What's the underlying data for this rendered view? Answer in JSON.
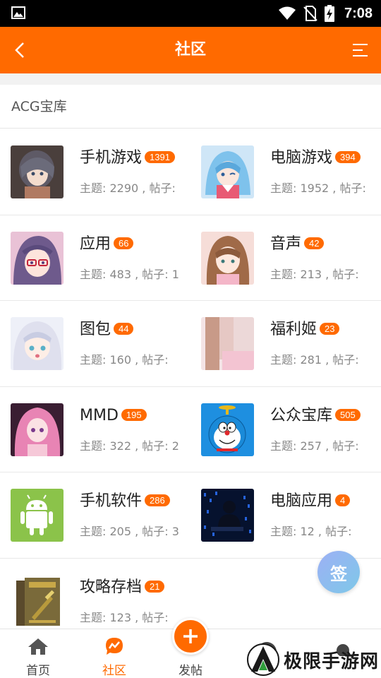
{
  "status_bar": {
    "time": "7:08",
    "icons": [
      "image-icon",
      "wifi-icon",
      "no-sim-icon",
      "battery-charging-icon"
    ]
  },
  "header": {
    "title": "社区",
    "back_icon": "chevron-left-icon",
    "menu_icon": "menu-lines-icon"
  },
  "section": {
    "title": "ACG宝库"
  },
  "categories": [
    {
      "name": "手机游戏",
      "count": "1391",
      "stats": "主题: 2290 , 帖子:"
    },
    {
      "name": "电脑游戏",
      "count": "394",
      "stats": "主题: 1952 , 帖子:"
    },
    {
      "name": "应用",
      "count": "66",
      "stats": "主题: 483 , 帖子: 1"
    },
    {
      "name": "音声",
      "count": "42",
      "stats": "主题: 213 , 帖子:"
    },
    {
      "name": "图包",
      "count": "44",
      "stats": "主题: 160 , 帖子:"
    },
    {
      "name": "福利姬",
      "count": "23",
      "stats": "主题: 281 , 帖子:"
    },
    {
      "name": "MMD",
      "count": "195",
      "stats": "主题: 322 , 帖子: 2"
    },
    {
      "name": "公众宝库",
      "count": "505",
      "stats": "主题: 257 , 帖子:"
    },
    {
      "name": "手机软件",
      "count": "286",
      "stats": "主题: 205 , 帖子: 3"
    },
    {
      "name": "电脑应用",
      "count": "4",
      "stats": "主题: 12 , 帖子:"
    },
    {
      "name": "攻略存档",
      "count": "21",
      "stats": "主题: 123 , 帖子:"
    }
  ],
  "fab": {
    "label": "签"
  },
  "tabbar": {
    "items": [
      {
        "label": "首页",
        "icon": "home-icon"
      },
      {
        "label": "社区",
        "icon": "community-icon",
        "active": true
      },
      {
        "label": "发帖",
        "icon": "plus-icon"
      },
      {
        "label": "",
        "icon": "message-icon"
      },
      {
        "label": "",
        "icon": "profile-icon"
      }
    ]
  },
  "watermark": {
    "text": "极限手游网"
  },
  "colors": {
    "accent": "#ff6a00",
    "status_bar": "#000000",
    "text_secondary": "#888888"
  }
}
